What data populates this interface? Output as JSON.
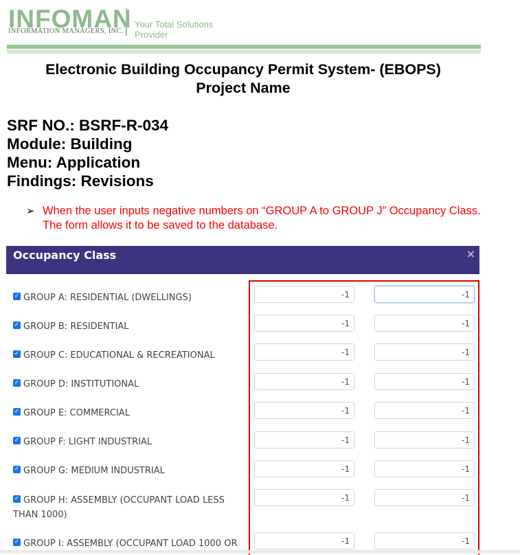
{
  "header": {
    "logo_main": "INFOMAN",
    "logo_sub": "INFORMATION MANAGERS, INC.",
    "tagline": "Your Total Solutions Provider"
  },
  "title_line1": "Electronic Building Occupancy Permit System- (EBOPS)",
  "title_line2": "Project Name",
  "meta": {
    "srf": "SRF NO.: BSRF-R-034",
    "module": "Module: Building",
    "menu": "Menu: Application",
    "findings": "Findings: Revisions"
  },
  "finding": {
    "bullet": "➢",
    "text": "When the user inputs negative numbers on “GROUP A to GROUP J” Occupancy Class. The form allows it to be saved to the database."
  },
  "modal": {
    "title": "Occupancy Class",
    "close": "×",
    "rows": [
      {
        "label": "GROUP A: RESIDENTIAL (DWELLINGS)",
        "value1": "-1",
        "value2": "-1"
      },
      {
        "label": "GROUP B: RESIDENTIAL",
        "value1": "-1",
        "value2": "-1"
      },
      {
        "label": "GROUP C: EDUCATIONAL & RECREATIONAL",
        "value1": "-1",
        "value2": "-1"
      },
      {
        "label": "GROUP D: INSTITUTIONAL",
        "value1": "-1",
        "value2": "-1"
      },
      {
        "label": "GROUP E: COMMERCIAL",
        "value1": "-1",
        "value2": "-1"
      },
      {
        "label": "GROUP F: LIGHT INDUSTRIAL",
        "value1": "-1",
        "value2": "-1"
      },
      {
        "label": "GROUP G: MEDIUM INDUSTRIAL",
        "value1": "-1",
        "value2": "-1"
      },
      {
        "label": "GROUP H: ASSEMBLY (OCCUPANT LOAD LESS THAN 1000)",
        "value1": "-1",
        "value2": "-1"
      },
      {
        "label": "GROUP I: ASSEMBLY (OCCUPANT LOAD 1000 OR",
        "value1": "-1",
        "value2": "-1"
      }
    ]
  },
  "colors": {
    "modal_header": "#3d3480",
    "finding_text": "#ff0000",
    "highlight_box": "#e00000",
    "logo_green": "#8fb98e"
  }
}
